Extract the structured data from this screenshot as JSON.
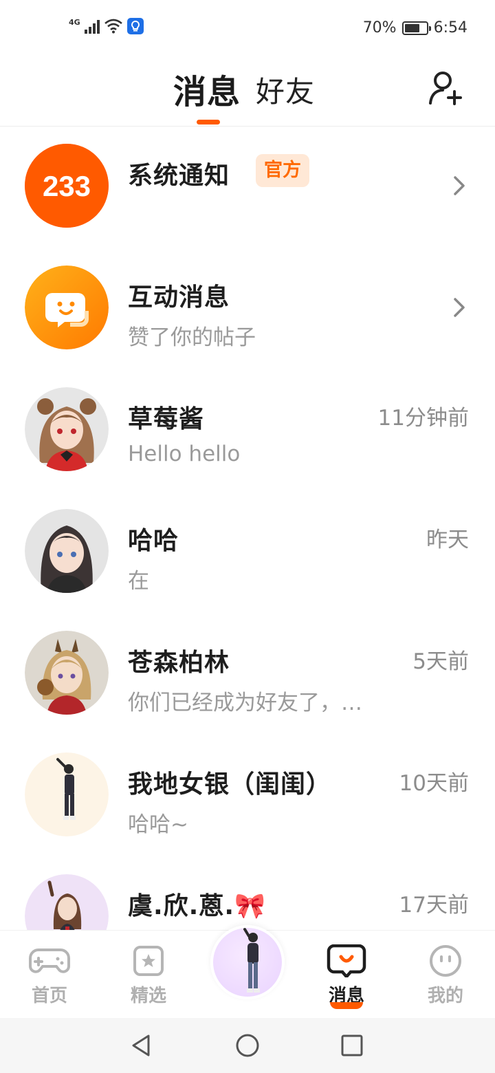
{
  "status_bar": {
    "network": "4G",
    "battery": "70%",
    "battery_level": 0.7,
    "time": "6:54"
  },
  "header": {
    "tab_messages": "消息",
    "tab_friends": "好友",
    "add_friend_icon": "add-friend-icon"
  },
  "conversations": [
    {
      "name": "系统通知",
      "badge": "官方",
      "preview": "",
      "time": "",
      "avatar_text": "233",
      "type": "system"
    },
    {
      "name": "互动消息",
      "preview": "赞了你的帖子",
      "time": "",
      "type": "interaction"
    },
    {
      "name": "草莓酱",
      "preview": "Hello hello",
      "time": "11分钟前",
      "type": "user"
    },
    {
      "name": "哈哈",
      "preview": "在",
      "time": "昨天",
      "type": "user"
    },
    {
      "name": "苍森柏林",
      "preview": "你们已经成为好友了，…",
      "time": "5天前",
      "type": "user"
    },
    {
      "name": "我地女银（闺闺）",
      "preview": "哈哈~",
      "time": "10天前",
      "type": "user"
    },
    {
      "name": "虞.欣.蒽.🎀",
      "preview": "",
      "time": "17天前",
      "type": "user"
    }
  ],
  "bottom_nav": {
    "home": "首页",
    "featured": "精选",
    "messages": "消息",
    "mine": "我的",
    "active": "消息"
  },
  "colors": {
    "accent": "#ff5a00",
    "badge_bg": "#ffe8d6",
    "system_avatar": "#ff5a00",
    "interaction_avatar": "#ff9a10"
  }
}
